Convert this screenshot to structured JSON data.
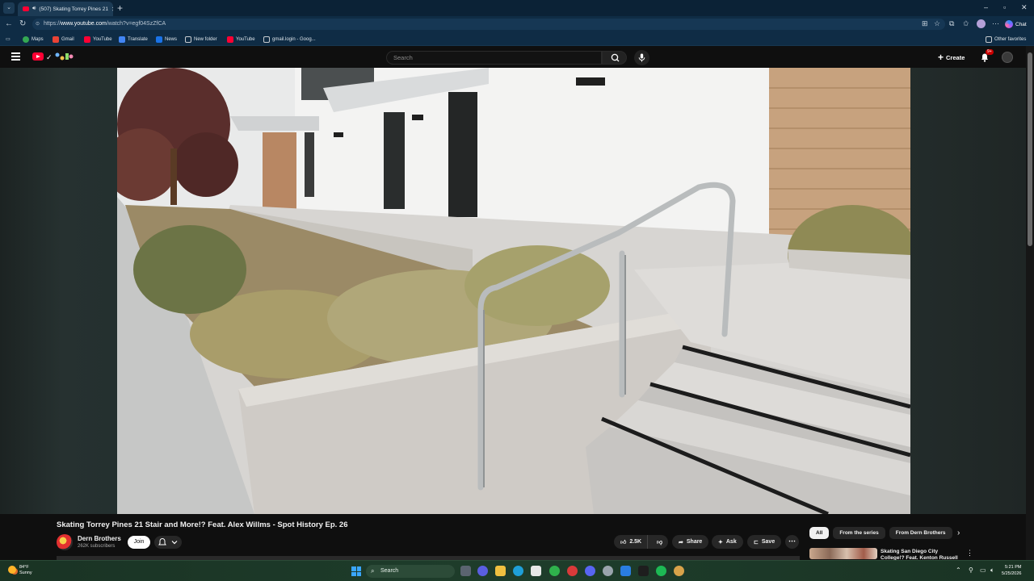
{
  "browser": {
    "tab_title": "(507) Skating Torrey Pines 21",
    "url_prefix": "https://",
    "url_domain": "www.youtube.com",
    "url_path": "/watch?v=egf04SzZfCA",
    "chat_label": "Chat",
    "window_controls": [
      "–",
      "▫",
      "✕"
    ]
  },
  "bookmarks": [
    {
      "label": "Maps",
      "color": "#34a853"
    },
    {
      "label": "Gmail",
      "color": "#ea4335"
    },
    {
      "label": "YouTube",
      "color": "#ff0033"
    },
    {
      "label": "Translate",
      "color": "#4285f4"
    },
    {
      "label": "News",
      "color": "#1a73e8"
    },
    {
      "label": "New folder",
      "color": "#c8ccd0"
    },
    {
      "label": "YouTube",
      "color": "#ff0033"
    },
    {
      "label": "gmail.login - Goog...",
      "color": "#c8ccd0"
    }
  ],
  "other_favorites": "Other favorites",
  "youtube": {
    "search_placeholder": "Search",
    "create_label": "Create",
    "notification_count": "9+"
  },
  "video": {
    "title": "Skating Torrey Pines 21 Stair and More!? Feat. Alex Willms - Spot History Ep. 26",
    "channel_name": "Dern Brothers",
    "subscribers": "262K subscribers",
    "join_label": "Join",
    "likes": "2.5K",
    "share_label": "Share",
    "ask_label": "Ask",
    "save_label": "Save"
  },
  "chips": [
    "All",
    "From the series",
    "From Dern Brothers"
  ],
  "recommendation": {
    "title": "Skating San Diego City College!? Feat. Kenton Russell"
  },
  "taskbar": {
    "weather_temp": "84°F",
    "weather_desc": "Sunny",
    "search_label": "Search",
    "time": "5:21 PM",
    "date": "5/25/2026"
  },
  "colors": {
    "browser_chrome": "#0f2c45",
    "youtube_bg": "#0f0f0f",
    "youtube_red": "#ff0033",
    "taskbar": "#1e3d2b"
  }
}
